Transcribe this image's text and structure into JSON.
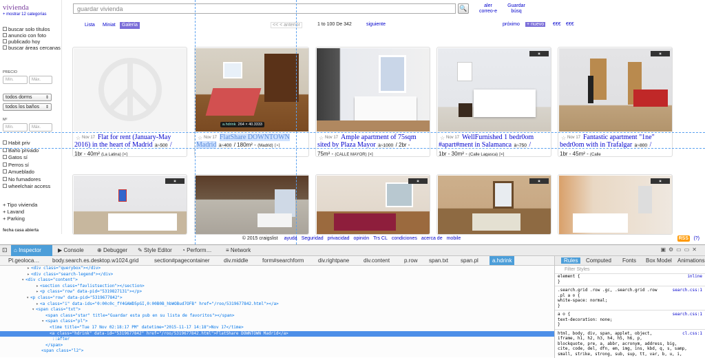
{
  "left": {
    "logo": "vivienda",
    "show_cats": "+ mostrar 12 categorías",
    "checks1": [
      "buscar solo títulos",
      "anuncio con foto",
      "publicado hoy",
      "buscar áreas cercanas"
    ],
    "precio": "PRECIO",
    "min": "Mín.",
    "max": "Máx.",
    "dorms": "todos dorms",
    "banos": "todos los baños",
    "m2": "M²",
    "checks2": [
      "Habit priv",
      "Baño privado",
      "Gatos sí",
      "Perros sí",
      "Amueblado",
      "No fumadores",
      "wheelchair access"
    ],
    "plus": [
      "+ Tipo vivienda",
      "+ Lavand",
      "+ Parking"
    ],
    "cut": "fecha casa abierta"
  },
  "search": {
    "placeholder": "guardar vivienda",
    "alert": "aler correo-e",
    "save": "Guardar búsq"
  },
  "views": {
    "list": "Lista",
    "thumb": "Miniat",
    "gallery": "Galería"
  },
  "pagination": {
    "prev": "<< < anterior",
    "range": "1 to 100 De 342",
    "next": "siguiente"
  },
  "right_nav": {
    "next": "próximo",
    "new": "+ nuevo",
    "e1": "€€€",
    "e2": "€€€"
  },
  "tooltip": {
    "name": "a.hdrink",
    "size": "264 × 40.3333"
  },
  "listings": [
    {
      "date": "Nov 17",
      "title": "Flat for rent (January-May 2016) in the heart of Madrid",
      "price": "à~500",
      "meta": "1br - 40m²",
      "area": "(La Latina)"
    },
    {
      "date": "Nov 17",
      "title": "FlatShare DOWNTOWN Madrid",
      "price": "à~400",
      "meta": "/ 180m² -",
      "area": "(Madrid)"
    },
    {
      "date": "Nov 17",
      "title": "Ample apartment of 75sqm sited by Plaza Mayor",
      "price": "à~1000",
      "meta": "75m² -",
      "area": "(CALLE MAYOR)",
      "extra": "/ 2br -"
    },
    {
      "date": "Nov 17",
      "title": "WellFurnished 1 bedr0om #apart#ment in Salamanca",
      "price": "à~750",
      "meta": "1br - 30m² -",
      "area": "(Calle Lagasca)"
    },
    {
      "date": "Nov 17",
      "title": "Fantastic apartment \"1ne\" bedr0om with in Trafalgar",
      "price": "à~800",
      "meta": "1br - 45m² -",
      "area": "(Calle"
    }
  ],
  "footer": {
    "copy": "© 2015 craigslist",
    "links": [
      "ayuda",
      "Seguridad",
      "privacidad",
      "opinión",
      "Trs CL",
      "condiciones",
      "acerca de",
      "mobile"
    ],
    "rss": "RSS",
    "help": "(?)"
  },
  "devtools": {
    "tabs": [
      "Inspector",
      "Console",
      "Debugger",
      "Style Editor",
      "Perform…",
      "Network"
    ],
    "crumbs": [
      "Pl.geoloca…",
      "body.search.es.desktop.w1024.grid",
      "section#pagecontainer",
      "div.middle",
      "form#searchform",
      "div.rightpane",
      "div.content",
      "p.row",
      "span.txt",
      "span.pl",
      "a.hdrink"
    ],
    "markup": [
      "<div class=\"querybox\"></div>",
      "<div class=\"search-legend\"></div>",
      "<div class=\"content\">",
      "<section class=\"favlistsection\"></section>",
      "<p class=\"row\" data-pid=\"5319827131\"></p>",
      "<p class=\"row\" data-pid=\"5319677842\">",
      "<a class=\"i\" data-ids=\"0:00c0c_fY4GAWD5pGI,0:00B0B_hbWOBud7OFB\" href=\"/roo/5319677842.html\"></a>",
      "<span class=\"txt\">",
      "<span class=\"star\" title=\"Guardar esta pub en su lista de favoritos\"></span>",
      "<span class=\"pl\">",
      "<time title=\"Tue 17 Nov 02:18:17 PM\" datetime=\"2015-11-17 14:18\">Nov 17</time>",
      "<a class=\"hdrink\" data-id=\"5319677842\" href=\"/roo/5319677842.html\">FlatShare DOWNTOWN Madrid</a>",
      "::after",
      "</span>",
      "<span class=\"l2\">"
    ],
    "rule_tabs": [
      "Rules",
      "Computed",
      "Fonts",
      "Box Model",
      "Animations"
    ],
    "filter": "Filter Styles",
    "rules": [
      {
        "sel": "element {",
        "src": "inline"
      },
      {
        "sel": "}"
      },
      {
        "sel": ".search.grid .row .gc, .search.grid .row",
        "src": "search.css:1"
      },
      {
        "sel": ".pl a ⊙ {"
      },
      {
        "sel": "  white-space: normal;"
      },
      {
        "sel": "}"
      },
      {
        "sel": "a ⊙ {",
        "src": "search.css:1"
      },
      {
        "sel": "  text-decoration: none;"
      },
      {
        "sel": "}"
      },
      {
        "sel": "html, body, div, span, applet, object,",
        "src": "cl.css:1"
      },
      {
        "sel": "iframe, h1, h2, h3, h4, h5, h6, p,"
      },
      {
        "sel": "blockquote, pre, a, abbr, acronym, address, big,"
      },
      {
        "sel": "cite, code, del, dfn, em, img, ins, kbd, q, s, samp,"
      },
      {
        "sel": "small, strike, strong, sub, sup, tt, var, b, u, i,"
      }
    ]
  }
}
